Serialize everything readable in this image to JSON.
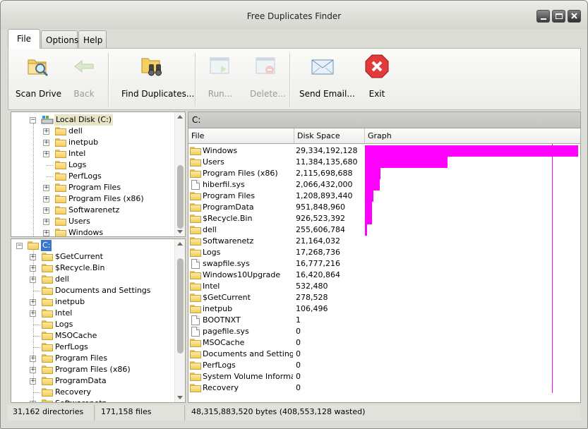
{
  "window": {
    "title": "Free Duplicates Finder"
  },
  "menu_tabs": [
    "File",
    "Options",
    "Help"
  ],
  "toolbar": {
    "scan_drive": "Scan Drive",
    "back": "Back",
    "find_duplicates": "Find Duplicates...",
    "run": "Run...",
    "delete": "Delete...",
    "send_email": "Send Email...",
    "exit": "Exit"
  },
  "drive_tree": {
    "root": "Local Disk (C:)",
    "items": [
      "dell",
      "inetpub",
      "Intel",
      "Logs",
      "PerfLogs",
      "Program Files",
      "Program Files (x86)",
      "Softwarenetz",
      "Users",
      "Windows"
    ]
  },
  "folder_tree": {
    "root": "C:",
    "items": [
      "$GetCurrent",
      "$Recycle.Bin",
      "dell",
      "Documents and Settings",
      "inetpub",
      "Intel",
      "Logs",
      "MSOCache",
      "PerfLogs",
      "Program Files",
      "Program Files (x86)",
      "ProgramData",
      "Recovery",
      "Softwarenetz"
    ]
  },
  "path": "C:",
  "columns": {
    "file": "File",
    "disk_space": "Disk Space",
    "graph": "Graph"
  },
  "files": [
    {
      "name": "Windows",
      "size": "29,334,192,128",
      "type": "folder",
      "bytes": 29334192128
    },
    {
      "name": "Users",
      "size": "11,384,135,680",
      "type": "folder",
      "bytes": 11384135680
    },
    {
      "name": "Program Files (x86)",
      "size": "2,115,698,688",
      "type": "folder",
      "bytes": 2115698688
    },
    {
      "name": "hiberfil.sys",
      "size": "2,066,432,000",
      "type": "file",
      "bytes": 2066432000
    },
    {
      "name": "Program Files",
      "size": "1,208,893,440",
      "type": "folder",
      "bytes": 1208893440
    },
    {
      "name": "ProgramData",
      "size": "951,848,960",
      "type": "folder",
      "bytes": 951848960
    },
    {
      "name": "$Recycle.Bin",
      "size": "926,523,392",
      "type": "folder",
      "bytes": 926523392
    },
    {
      "name": "dell",
      "size": "255,606,784",
      "type": "folder",
      "bytes": 255606784
    },
    {
      "name": "Softwarenetz",
      "size": "21,164,032",
      "type": "folder",
      "bytes": 21164032
    },
    {
      "name": "Logs",
      "size": "17,268,736",
      "type": "folder",
      "bytes": 17268736
    },
    {
      "name": "swapfile.sys",
      "size": "16,777,216",
      "type": "file",
      "bytes": 16777216
    },
    {
      "name": "Windows10Upgrade",
      "size": "16,420,864",
      "type": "folder",
      "bytes": 16420864
    },
    {
      "name": "Intel",
      "size": "532,480",
      "type": "folder",
      "bytes": 532480
    },
    {
      "name": "$GetCurrent",
      "size": "278,528",
      "type": "folder",
      "bytes": 278528
    },
    {
      "name": "inetpub",
      "size": "106,496",
      "type": "folder",
      "bytes": 106496
    },
    {
      "name": "BOOTNXT",
      "size": "1",
      "type": "file",
      "bytes": 1
    },
    {
      "name": "pagefile.sys",
      "size": "0",
      "type": "file",
      "bytes": 0
    },
    {
      "name": "MSOCache",
      "size": "0",
      "type": "folder",
      "bytes": 0
    },
    {
      "name": "Documents and Settings",
      "size": "0",
      "type": "folder",
      "bytes": 0
    },
    {
      "name": "PerfLogs",
      "size": "0",
      "type": "folder",
      "bytes": 0
    },
    {
      "name": "System Volume Informa...",
      "size": "0",
      "type": "folder",
      "bytes": 0
    },
    {
      "name": "Recovery",
      "size": "0",
      "type": "folder",
      "bytes": 0
    }
  ],
  "status": {
    "directories": "31,162 directories",
    "files": "171,158 files",
    "bytes": "48,315,883,520 bytes  (408,553,128 wasted)"
  },
  "colors": {
    "graph": "#ff00ff",
    "folder": "#f2cd5f",
    "selection": "#cde6f7"
  },
  "icons": [
    "scan-drive-icon",
    "back-arrow-icon",
    "binoculars-icon",
    "run-icon",
    "delete-icon",
    "email-icon",
    "exit-icon",
    "drive-icon",
    "folder-icon",
    "file-icon"
  ]
}
